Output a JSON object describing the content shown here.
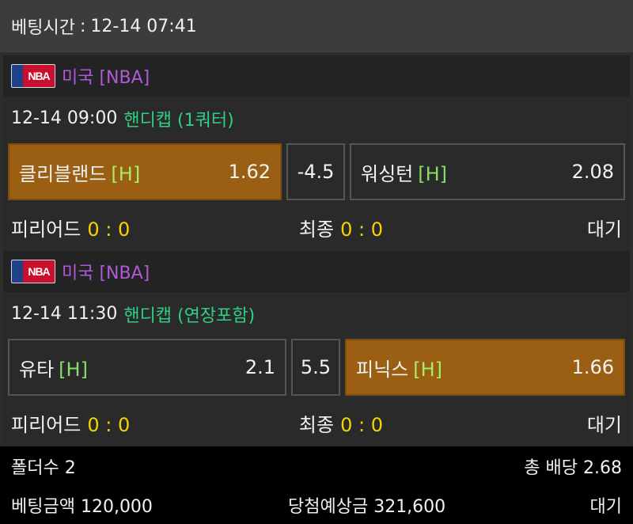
{
  "header": {
    "label": "베팅시간",
    "separator": ":",
    "time": "12-14 07:41"
  },
  "bets": [
    {
      "league": {
        "logo_text": "NBA",
        "name": "미국 [NBA]"
      },
      "match": {
        "time": "12-14 09:00",
        "type": "핸디캡 (1쿼터)"
      },
      "home": {
        "team": "클리블랜드",
        "marker": "[H]",
        "odds": "1.62",
        "selected": true
      },
      "handicap": "-4.5",
      "away": {
        "team": "워싱턴",
        "marker": "[H]",
        "odds": "2.08",
        "selected": false
      },
      "period_label": "피리어드",
      "period_score": "0 : 0",
      "final_label": "최종",
      "final_score": "0 : 0",
      "status": "대기"
    },
    {
      "league": {
        "logo_text": "NBA",
        "name": "미국 [NBA]"
      },
      "match": {
        "time": "12-14 11:30",
        "type": "핸디캡 (연장포함)"
      },
      "home": {
        "team": "유타",
        "marker": "[H]",
        "odds": "2.1",
        "selected": false
      },
      "handicap": "5.5",
      "away": {
        "team": "피닉스",
        "marker": "[H]",
        "odds": "1.66",
        "selected": true
      },
      "period_label": "피리어드",
      "period_score": "0 : 0",
      "final_label": "최종",
      "final_score": "0 : 0",
      "status": "대기"
    }
  ],
  "footer": {
    "folder_count": "폴더수 2",
    "total_odds": "총 배당 2.68",
    "bet_amount": "베팅금액 120,000",
    "expected_win": "당첨예상금 321,600",
    "status": "대기"
  },
  "colors": {
    "selected_pick": "#9a5f12",
    "league_text": "#b05ad8",
    "match_type": "#2fd083",
    "home_marker": "#88dd66",
    "score": "#f5d400"
  }
}
